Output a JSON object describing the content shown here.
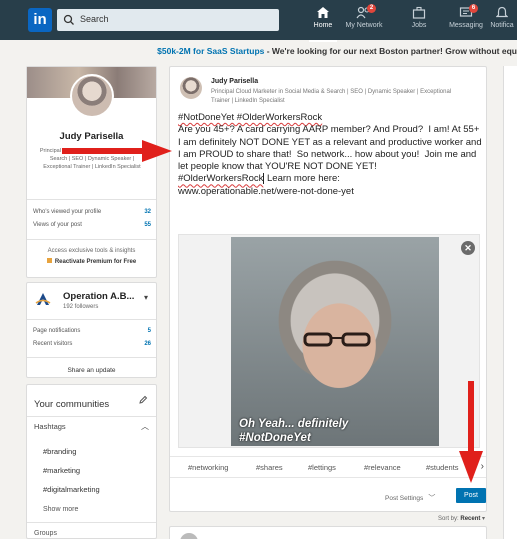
{
  "nav": {
    "logo": "in",
    "search_placeholder": "Search",
    "items": [
      {
        "label": "Home",
        "icon": "home-icon",
        "badge": ""
      },
      {
        "label": "My Network",
        "icon": "network-icon",
        "badge": "2"
      },
      {
        "label": "Jobs",
        "icon": "jobs-icon",
        "badge": ""
      },
      {
        "label": "Messaging",
        "icon": "messaging-icon",
        "badge": "6"
      },
      {
        "label": "Notifica",
        "icon": "bell-icon",
        "badge": ""
      }
    ]
  },
  "promo": {
    "link": "$50k-2M for SaaS Startups",
    "text": " - We're looking for our next Boston partner! Grow without equ"
  },
  "profile": {
    "name": "Judy Parisella",
    "headline": "Principal Cloud Marketer in Social Media & Search | SEO | Dynamic Speaker | Exceptional Trainer | LinkedIn Specialist",
    "stats": [
      {
        "label": "Who's viewed your profile",
        "value": "32"
      },
      {
        "label": "Views of your post",
        "value": "55"
      }
    ],
    "premium_line": "Access exclusive tools & insights",
    "premium_cta": "Reactivate Premium for Free"
  },
  "page": {
    "name": "Operation A.B...",
    "followers": "192 followers",
    "stats": [
      {
        "label": "Page notifications",
        "value": "5"
      },
      {
        "label": "Recent visitors",
        "value": "26"
      }
    ],
    "share": "Share an update"
  },
  "communities": {
    "title": "Your communities",
    "hashtags_label": "Hashtags",
    "hashtags": [
      "#branding",
      "#marketing",
      "#digitalmarketing"
    ],
    "show_more": "Show more",
    "groups": "Groups"
  },
  "post": {
    "author": "Judy Parisella",
    "author_headline": "Principal Cloud Marketer in Social Media & Search | SEO | Dynamic Speaker | Exceptional Trainer | LinkedIn Specialist",
    "line1": "#NotDoneYet #OlderWorkersRock",
    "body": "Are you 45+? A card carrying AARP member? And Proud?  I am! At 55+ I am definitely NOT DONE YET as a relevant and productive worker and I am PROUD to share that!  So network... how about you!  Join me and let people know that YOU'RE NOT DONE YET!",
    "line_tag": "#OlderWorkersRock",
    "line_tag_rest": " Learn more here:",
    "url": "www.operationable.net/were-not-done-yet",
    "photo_caption_1": "Oh Yeah... definitely",
    "photo_caption_2": "#NotDoneYet",
    "close": "✕",
    "tags": [
      "#networking",
      "#shares",
      "#lettings",
      "#relevance",
      "#students"
    ],
    "post_settings": "Post Settings",
    "post_button": "Post"
  },
  "feed": {
    "sort_label": "Sort by:",
    "sort_value": "Recent"
  },
  "colors": {
    "nav_bg": "#283e4a",
    "brand": "#0073b1",
    "arrow": "#e0201b"
  }
}
